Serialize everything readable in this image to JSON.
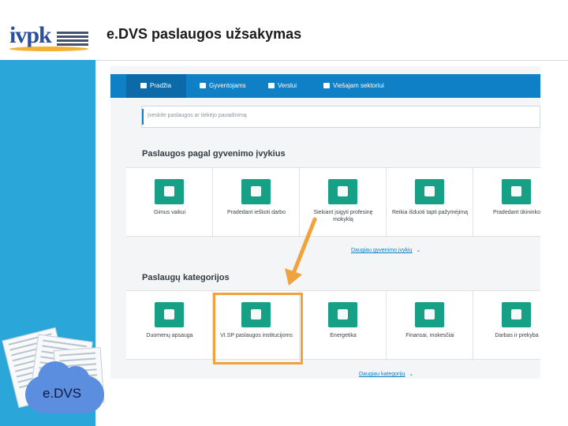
{
  "logo": {
    "text": "ivpk"
  },
  "slide_title": "e.DVS paslaugos užsakymas",
  "illustration": {
    "label": "e.DVS"
  },
  "screenshot": {
    "nav": [
      {
        "label": "Pradžia",
        "icon": "home-icon"
      },
      {
        "label": "Gyventojams",
        "icon": "users-icon"
      },
      {
        "label": "Verslui",
        "icon": "briefcase-icon"
      },
      {
        "label": "Viešajam sektoriui",
        "icon": "institution-icon"
      }
    ],
    "search": {
      "placeholder": "Įveskite paslaugos ar tiekėjo pavadinimą"
    },
    "life_events": {
      "title": "Paslaugos pagal gyvenimo įvykius",
      "tiles": [
        {
          "label": "Gimus vaikui",
          "icon": "stroller-icon"
        },
        {
          "label": "Pradedant ieškoti darbo",
          "icon": "cv-icon"
        },
        {
          "label": "Siekiant įsigyti profesinę mokyklą",
          "icon": "graduation-cap-icon"
        },
        {
          "label": "Reikia išduoti tapti pažymėjimą",
          "icon": "id-card-icon"
        },
        {
          "label": "Pradedant ūkininko",
          "icon": "tractor-icon"
        }
      ],
      "more_label": "Daugiau gyvenimo įvykių"
    },
    "categories": {
      "title": "Paslaugų kategorijos",
      "tiles": [
        {
          "label": "Duomenų apsauga",
          "icon": "shield-lock-icon"
        },
        {
          "label": "VI.SP paslaugos institucijoms",
          "icon": "building-icon"
        },
        {
          "label": "Energetika",
          "icon": "battery-icon"
        },
        {
          "label": "Finansai, mokesčiai",
          "icon": "money-icon"
        },
        {
          "label": "Darbas ir prekyba",
          "icon": "factory-icon"
        }
      ],
      "more_label": "Daugiau kategorijų"
    }
  },
  "colors": {
    "left_bar": "#2ba6d9",
    "nav": "#0f7fc6",
    "tile_icon": "#16a085",
    "highlight": "#f0a23c"
  }
}
